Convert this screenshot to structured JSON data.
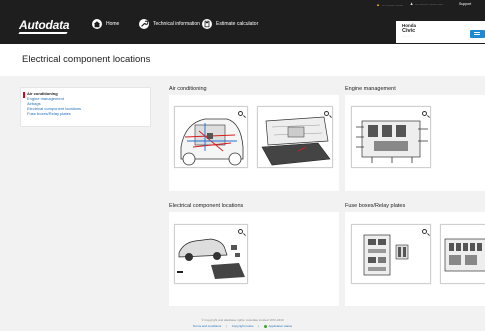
{
  "header": {
    "logo": "Autodata",
    "nav": [
      {
        "label": "Home",
        "icon": "home-icon"
      },
      {
        "label": "Technical information",
        "icon": "wrench-icon"
      },
      {
        "label": "Estimate calculator",
        "icon": "calculator-icon"
      }
    ],
    "util": [
      {
        "label": "... ......... ........"
      },
      {
        "label": "... ......... ........ ......"
      }
    ],
    "support": "Support",
    "vehicle": {
      "make": "Honda",
      "model": "Civic",
      "sub": "... ... ..."
    }
  },
  "page_title": "Electrical component locations",
  "sidebar": {
    "items": [
      {
        "label": "Air conditioning",
        "active": true
      },
      {
        "label": "Engine management",
        "active": false
      },
      {
        "label": "Airbags",
        "active": false
      },
      {
        "label": "Electrical component locations",
        "active": false
      },
      {
        "label": "Fuse boxes/Relay plates",
        "active": false
      }
    ]
  },
  "sections": [
    {
      "title": "Air conditioning"
    },
    {
      "title": "Engine management"
    },
    {
      "title": "Electrical component locations"
    },
    {
      "title": "Fuse boxes/Relay plates"
    }
  ],
  "footer": {
    "copyright": "© Copyright and database rights: Autodata Limited 1972-2019",
    "links": [
      "Terms and conditions",
      "Copyright notice",
      "Application status"
    ]
  },
  "colors": {
    "accent": "#1f8ad4",
    "header_bg": "#1e1e1e",
    "active_marker": "#e0001b",
    "link": "#1f6fb8"
  }
}
